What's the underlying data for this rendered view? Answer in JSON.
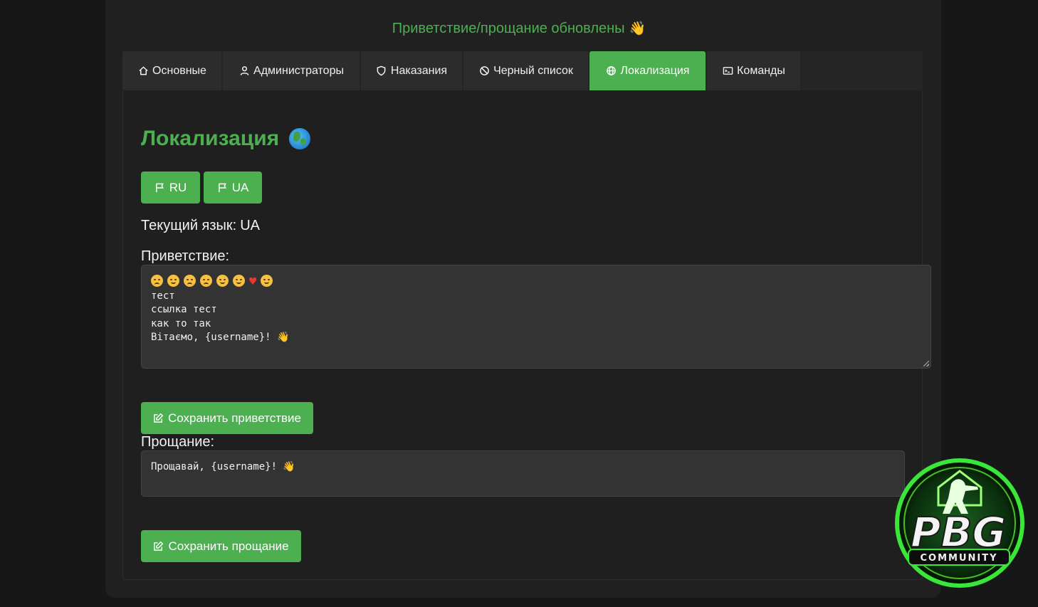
{
  "notice": {
    "text": "Приветствие/прощание обновлены",
    "emoji": "👋"
  },
  "tabs": [
    {
      "label": "Основные",
      "icon": "home-icon"
    },
    {
      "label": "Администраторы",
      "icon": "user-icon"
    },
    {
      "label": "Наказания",
      "icon": "shield-icon"
    },
    {
      "label": "Черный список",
      "icon": "ban-icon"
    },
    {
      "label": "Локализация",
      "icon": "globe-icon",
      "active": true
    },
    {
      "label": "Команды",
      "icon": "terminal-icon"
    }
  ],
  "page": {
    "title": "Локализация",
    "title_icon": "earth-globe-icon",
    "languages": [
      {
        "label": "RU",
        "icon": "flag-icon"
      },
      {
        "label": "UA",
        "icon": "flag-icon"
      }
    ],
    "current_language_label": "Текущий язык:",
    "current_language_value": "UA"
  },
  "greeting": {
    "label": "Приветствие:",
    "lines": [
      "тест",
      "ссылка тест",
      "как то так",
      "Вітаємо, {username}! 👋"
    ],
    "save_label": "Сохранить приветствие"
  },
  "farewell": {
    "label": "Прощание:",
    "text": "Прощавай, {username}! 👋",
    "save_label": "Сохранить прощание"
  },
  "logo": {
    "main": "PBG",
    "sub": "COMMUNITY"
  },
  "colors": {
    "accent": "#4caf50",
    "background": "#171717",
    "panel": "#202020",
    "input": "#333333"
  }
}
